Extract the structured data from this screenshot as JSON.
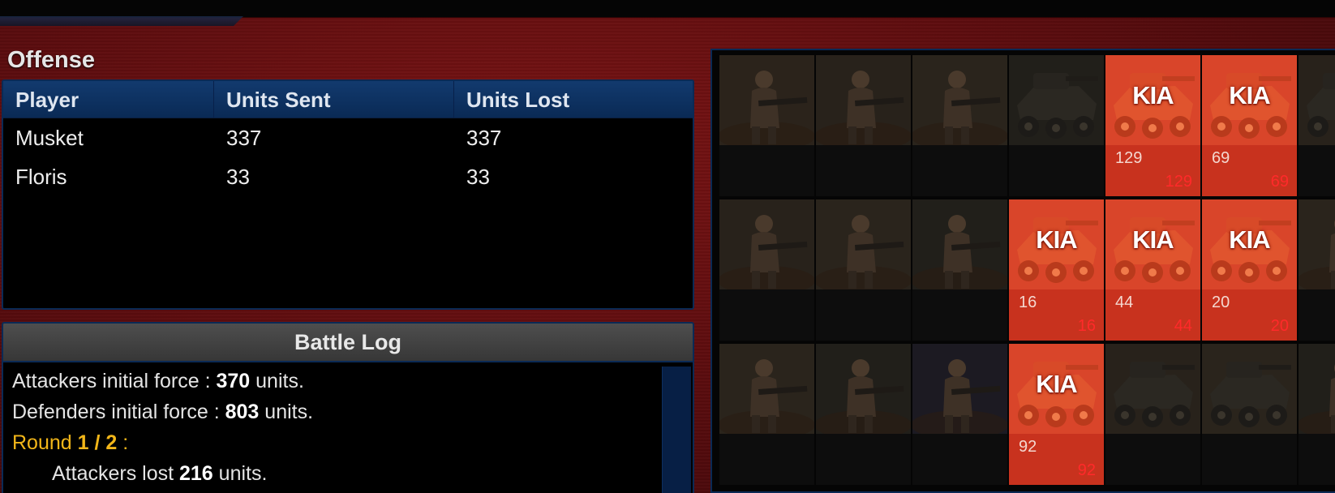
{
  "offense": {
    "title": "Offense",
    "headers": {
      "player": "Player",
      "sent": "Units Sent",
      "lost": "Units Lost"
    },
    "rows": [
      {
        "player": "Musket",
        "sent": "337",
        "lost": "337"
      },
      {
        "player": "Floris",
        "sent": "33",
        "lost": "33"
      }
    ]
  },
  "battle_log": {
    "title": "Battle Log",
    "lines": [
      {
        "pre": "Attackers initial force : ",
        "val": "370",
        "post": " units."
      },
      {
        "pre": "Defenders initial force : ",
        "val": "803",
        "post": " units."
      },
      {
        "pre": "Round ",
        "val": "1 / 2",
        "post": " :"
      },
      {
        "pre": "Attackers lost ",
        "val": "216",
        "post": " units."
      }
    ]
  },
  "units": {
    "kia_label": "KIA",
    "rows": [
      [
        {
          "type": "infantry",
          "status": "none"
        },
        {
          "type": "infantry",
          "status": "none"
        },
        {
          "type": "infantry",
          "status": "none"
        },
        {
          "type": "tank",
          "status": "none"
        },
        {
          "type": "tank",
          "status": "kia",
          "sent": "129",
          "lost": "129"
        },
        {
          "type": "tank",
          "status": "kia",
          "sent": "69",
          "lost": "69"
        },
        {
          "type": "tank",
          "status": "none"
        }
      ],
      [
        {
          "type": "infantry",
          "status": "none"
        },
        {
          "type": "infantry",
          "status": "none"
        },
        {
          "type": "infantry",
          "status": "none"
        },
        {
          "type": "tank",
          "status": "kia",
          "sent": "16",
          "lost": "16"
        },
        {
          "type": "tank",
          "status": "kia",
          "sent": "44",
          "lost": "44"
        },
        {
          "type": "tank",
          "status": "kia",
          "sent": "20",
          "lost": "20"
        },
        {
          "type": "infantry",
          "status": "none"
        }
      ],
      [
        {
          "type": "infantry",
          "status": "none"
        },
        {
          "type": "infantry",
          "status": "none"
        },
        {
          "type": "infantry",
          "status": "none"
        },
        {
          "type": "tank",
          "status": "kia",
          "sent": "92",
          "lost": "92"
        },
        {
          "type": "tank",
          "status": "none"
        },
        {
          "type": "tank",
          "status": "none"
        },
        {
          "type": "infantry",
          "status": "none"
        }
      ]
    ]
  }
}
